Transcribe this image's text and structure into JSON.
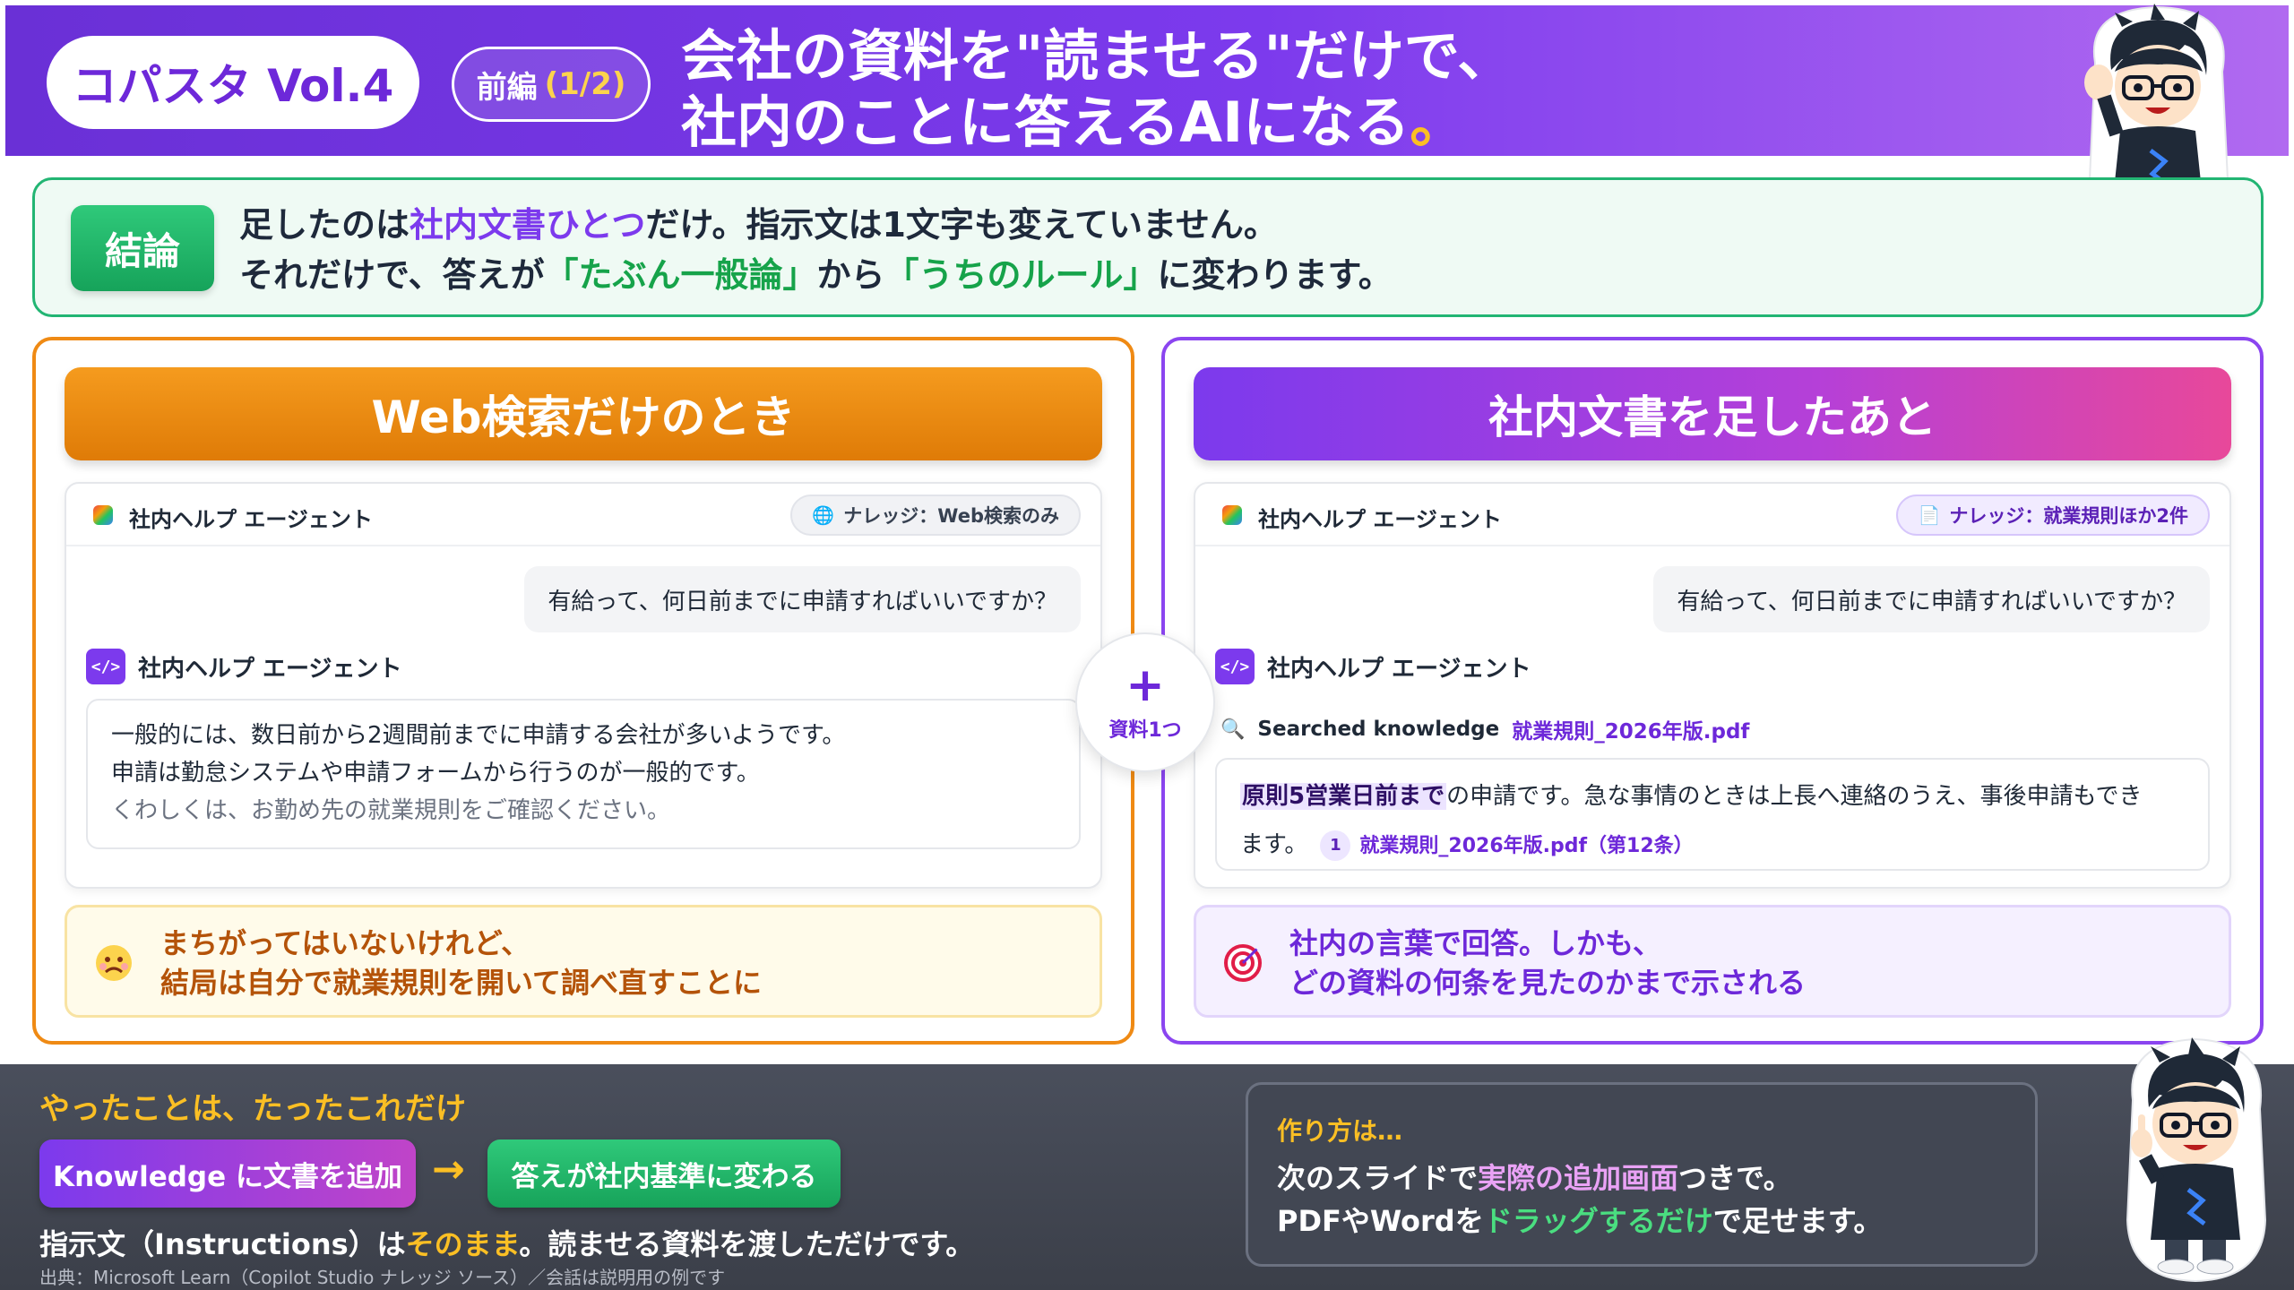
{
  "header": {
    "series": "コパスタ Vol.4",
    "part_label": "前編",
    "part_num": "(1/2)",
    "title_line1": "会社の資料を\"読ませる\"だけで、",
    "title_line2": "社内のことに答えるAIになる",
    "title_dot": "。"
  },
  "conclusion": {
    "badge": "結論",
    "line1_a": "足したのは",
    "line1_hl": "社内文書ひとつ",
    "line1_b": "だけ。指示文は1文字も変えていません。",
    "line2_a": "それだけで、答えが",
    "line2_hl1": "「たぶん一般論」",
    "line2_b": "から",
    "line2_hl2": "「うちのルール」",
    "line2_c": "に変わります。"
  },
  "left_panel": {
    "heading": "Web検索だけのとき",
    "agent_name": "社内ヘルプ エージェント",
    "knowledge_chip": "ナレッジ：Web検索のみ",
    "knowledge_icon": "globe-icon",
    "user_question": "有給って、何日前までに申請すればいいですか？",
    "reply_agent_name": "社内ヘルプ エージェント",
    "answer_line1": "一般的には、数日前から2週間前までに申請する会社が多いようです。",
    "answer_line2": "申請は勤怠システムや申請フォームから行うのが一般的です。",
    "answer_line3": "くわしくは、お勤め先の就業規則をご確認ください。",
    "note_icon": "worried-face-icon",
    "note_line1": "まちがってはいないけれど、",
    "note_line2": "結局は自分で就業規則を開いて調べ直すことに"
  },
  "right_panel": {
    "heading": "社内文書を足したあと",
    "agent_name": "社内ヘルプ エージェント",
    "knowledge_chip": "ナレッジ：就業規則ほか2件",
    "knowledge_icon": "document-icon",
    "user_question": "有給って、何日前までに申請すればいいですか？",
    "reply_agent_name": "社内ヘルプ エージェント",
    "search_label": "Searched knowledge",
    "search_file": "就業規則_2026年版.pdf",
    "answer_highlight": "原則5営業日前まで",
    "answer_rest_line1": "の申請です。急な事情のときは上長へ連絡のうえ、事後申請もでき",
    "answer_line2": "ます。",
    "citation_number": "1",
    "citation_text": "就業規則_2026年版.pdf（第12条）",
    "note_icon": "target-icon",
    "note_line1": "社内の言葉で回答。しかも、",
    "note_line2": "どの資料の何条を見たのかまで示される"
  },
  "plus_badge": {
    "symbol": "+",
    "label": "資料1つ"
  },
  "footer": {
    "heading": "やったことは、たったこれだけ",
    "step1": "Knowledge に文書を追加",
    "arrow": "→",
    "step2": "答えが社内基準に変わる",
    "line_a": "指示文（Instructions）は",
    "line_hl": "そのまま",
    "line_b": "。読ませる資料を渡しただけです。",
    "source": "出典：Microsoft Learn（Copilot Studio ナレッジ ソース）／会話は説明用の例です",
    "howto_title": "作り方は…",
    "howto_line1_a": "次のスライドで",
    "howto_line1_hl": "実際の追加画面",
    "howto_line1_b": "つきで。",
    "howto_line2_a": "PDFやWordを",
    "howto_line2_hl": "ドラッグするだけ",
    "howto_line2_b": "で足せます。"
  },
  "colors": {
    "header_purple": "#7c3aed",
    "orange": "#ef8a14",
    "purple": "#8b45f0",
    "green": "#22b573",
    "yellow": "#fbbf24",
    "footer_bg": "#454a55"
  }
}
